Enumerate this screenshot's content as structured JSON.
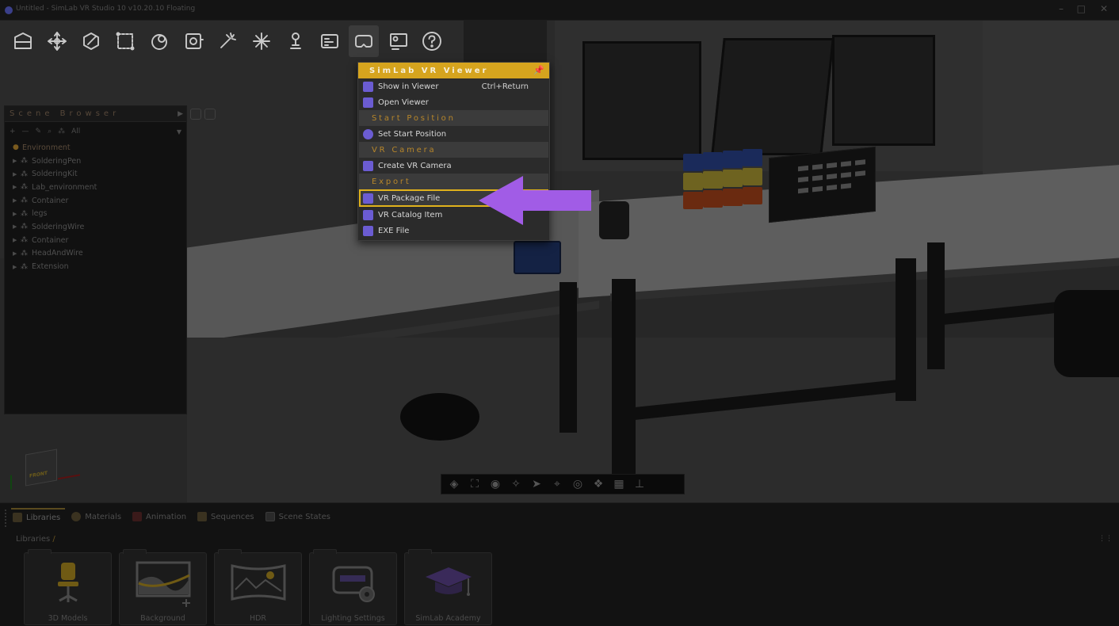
{
  "window": {
    "title": "Untitled - SimLab VR Studio 10 v10.20.10 Floating",
    "controls": [
      "–",
      "□",
      "✕"
    ]
  },
  "toolbar": {
    "buttons": [
      {
        "name": "import-icon"
      },
      {
        "name": "transform-icon"
      },
      {
        "name": "edit-icon"
      },
      {
        "name": "selection-icon"
      },
      {
        "name": "materials-icon"
      },
      {
        "name": "render-icon"
      },
      {
        "name": "effects-icon"
      },
      {
        "name": "lights-icon"
      },
      {
        "name": "avatar-icon"
      },
      {
        "name": "scenes-icon"
      },
      {
        "name": "vr-headset-icon"
      },
      {
        "name": "presentation-icon"
      },
      {
        "name": "help-icon"
      }
    ]
  },
  "vr_menu": {
    "header": "SimLab VR Viewer",
    "items": {
      "show_in_viewer": "Show in Viewer",
      "show_in_viewer_shortcut": "Ctrl+Return",
      "open_viewer": "Open Viewer",
      "start_position_section": "Start Position",
      "set_start_position": "Set Start Position",
      "vr_camera_section": "VR Camera",
      "create_vr_camera": "Create VR Camera",
      "export_section": "Export",
      "vr_package_file": "VR Package File",
      "vr_catalog_item": "VR Catalog Item",
      "exe_file": "EXE File"
    },
    "accent": "#d6a41e",
    "highlight_border": "#e0b21c",
    "arrow_color": "#a15ce6"
  },
  "scene_browser": {
    "title": "Scene Browser",
    "filter_label": "All",
    "items": [
      "Environment",
      "SolderingPen",
      "SolderingKit",
      "Lab_environment",
      "Container",
      "legs",
      "SolderingWire",
      "Container",
      "HeadAndWire",
      "Extension"
    ]
  },
  "nav_cube": {
    "face_label": "FRONT"
  },
  "bottom_panel": {
    "tabs": [
      "Libraries",
      "Materials",
      "Animation",
      "Sequences",
      "Scene States"
    ],
    "breadcrumb": "Libraries",
    "breadcrumb_sep": "/",
    "library_items": [
      "3D Models",
      "Background",
      "HDR",
      "Lighting Settings",
      "SimLab Academy"
    ]
  }
}
